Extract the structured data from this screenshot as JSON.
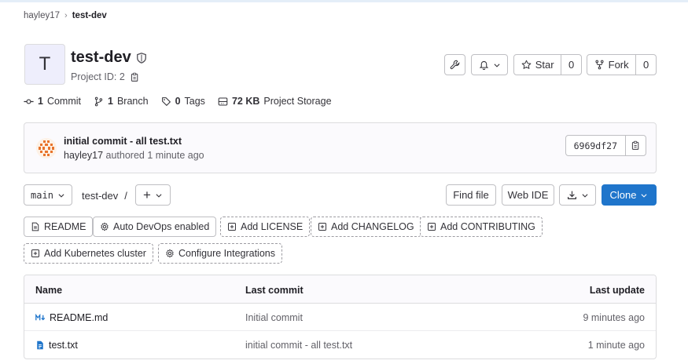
{
  "breadcrumb": {
    "group": "hayley17",
    "project": "test-dev"
  },
  "project": {
    "avatar_letter": "T",
    "name": "test-dev",
    "id_label": "Project ID: 2"
  },
  "actions": {
    "star_label": "Star",
    "star_count": "0",
    "fork_label": "Fork",
    "fork_count": "0"
  },
  "stats": [
    {
      "count": "1",
      "label": "Commit"
    },
    {
      "count": "1",
      "label": "Branch"
    },
    {
      "count": "0",
      "label": "Tags"
    },
    {
      "count": "72 KB",
      "label": "Project Storage"
    }
  ],
  "last_commit": {
    "title": "initial commit - all test.txt",
    "author": "hayley17",
    "meta": "authored 1 minute ago",
    "sha": "6969df27"
  },
  "repo_toolbar": {
    "branch": "main",
    "path": "test-dev",
    "path_sep": "/",
    "add_symbol": "+",
    "find_file": "Find file",
    "web_ide": "Web IDE",
    "clone": "Clone"
  },
  "quick_links": [
    "README",
    "Auto DevOps enabled",
    "Add LICENSE",
    "Add CHANGELOG",
    "Add CONTRIBUTING",
    "Add Kubernetes cluster",
    "Configure Integrations"
  ],
  "file_table": {
    "headers": {
      "name": "Name",
      "last_commit": "Last commit",
      "last_update": "Last update"
    },
    "rows": [
      {
        "name": "README.md",
        "commit": "Initial commit",
        "updated": "9 minutes ago",
        "icon": "markdown-icon"
      },
      {
        "name": "test.txt",
        "commit": "initial commit - all test.txt",
        "updated": "1 minute ago",
        "icon": "file-icon"
      }
    ]
  },
  "colors": {
    "primary": "#1f75cb",
    "link_icon": "#1f75cb",
    "avatar_bg": "#eeeefc"
  }
}
